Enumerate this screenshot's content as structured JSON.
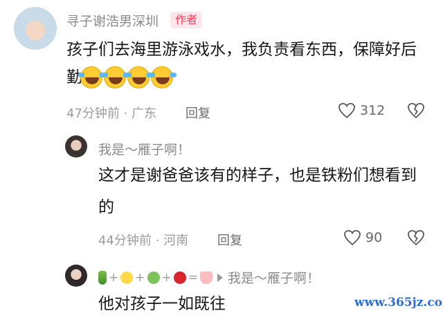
{
  "comment1": {
    "username": "寻子谢浩男深圳",
    "badge": "作者",
    "text_line1": "孩子们去海里游泳戏水，我负责看东西，保障好后",
    "text_line2": "勤",
    "time_location": "47分钟前 · 广东",
    "reply_label": "回复",
    "likes": "312"
  },
  "comment2": {
    "username": "我是～雁子啊！",
    "text_line1": "这才是谢爸爸该有的样子，也是铁粉们想看到",
    "text_line2": "的",
    "time_location": "44分钟前 · 河南",
    "reply_label": "回复",
    "likes": "90"
  },
  "comment3": {
    "plus": "+",
    "equals": "=",
    "reply_to": "我是～雁子啊！",
    "text": "他对孩子一如既往"
  },
  "watermark": "www.365jz.com",
  "colors": {
    "badge_text": "#ff3b5c",
    "badge_bg": "#fde7ea",
    "meta": "#9a9a9a",
    "watermark": "#2d6fd1"
  }
}
